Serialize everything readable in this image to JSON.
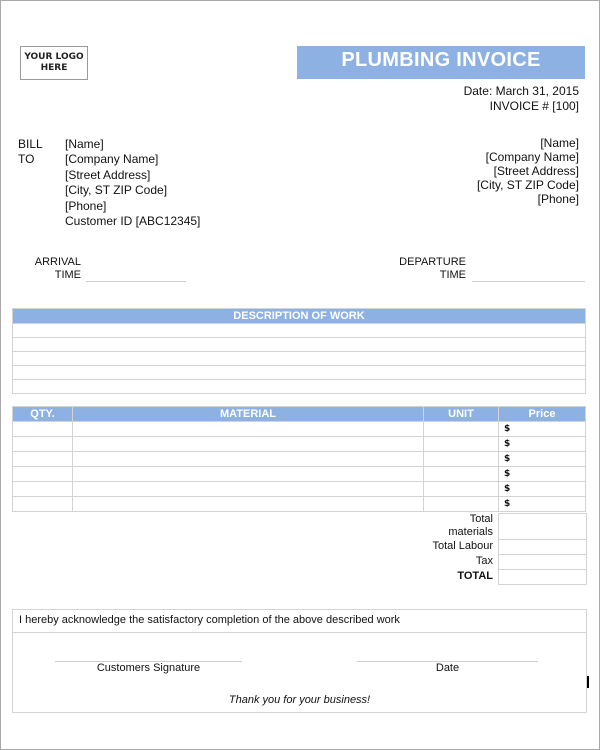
{
  "logo": {
    "line1": "YOUR LOGO",
    "line2": "HERE"
  },
  "header": {
    "title": "PLUMBING INVOICE",
    "date": "Date: March 31, 2015",
    "invoice_number": "INVOICE # [100]"
  },
  "bill_to": {
    "label_line1": "BILL",
    "label_line2": "TO",
    "lines": [
      "[Name]",
      "[Company Name]",
      "[Street Address]",
      "[City, ST  ZIP Code]",
      "[Phone]",
      "Customer ID [ABC12345]"
    ]
  },
  "company": {
    "lines": [
      "[Name]",
      "[Company Name]",
      "[Street Address]",
      "[City, ST  ZIP Code]",
      "[Phone]"
    ]
  },
  "times": {
    "arrival_line1": "ARRIVAL",
    "arrival_line2": "TIME",
    "arrival_value": "",
    "departure_line1": "DEPARTURE",
    "departure_line2": "TIME",
    "departure_value": ""
  },
  "description": {
    "header": "DESCRIPTION OF WORK",
    "rows": [
      "",
      "",
      "",
      "",
      ""
    ]
  },
  "materials": {
    "headers": [
      "QTY.",
      "MATERIAL",
      "UNIT",
      "Price"
    ],
    "currency_symbol": "$",
    "rows": [
      {
        "qty": "",
        "material": "",
        "unit": "",
        "price": ""
      },
      {
        "qty": "",
        "material": "",
        "unit": "",
        "price": ""
      },
      {
        "qty": "",
        "material": "",
        "unit": "",
        "price": ""
      },
      {
        "qty": "",
        "material": "",
        "unit": "",
        "price": ""
      },
      {
        "qty": "",
        "material": "",
        "unit": "",
        "price": ""
      },
      {
        "qty": "",
        "material": "",
        "unit": "",
        "price": ""
      }
    ]
  },
  "totals": {
    "total_materials_line1": "Total",
    "total_materials_line2": "materials",
    "total_labour": "Total Labour",
    "tax": "Tax",
    "total": "TOTAL"
  },
  "acknowledgement": {
    "text": "I hereby acknowledge the satisfactory completion of the above described work",
    "signature_label": "Customers Signature",
    "date_label": "Date",
    "thanks": "Thank you for your business!"
  },
  "colors": {
    "accent": "#8db1e2",
    "border": "#d3d3d3"
  }
}
